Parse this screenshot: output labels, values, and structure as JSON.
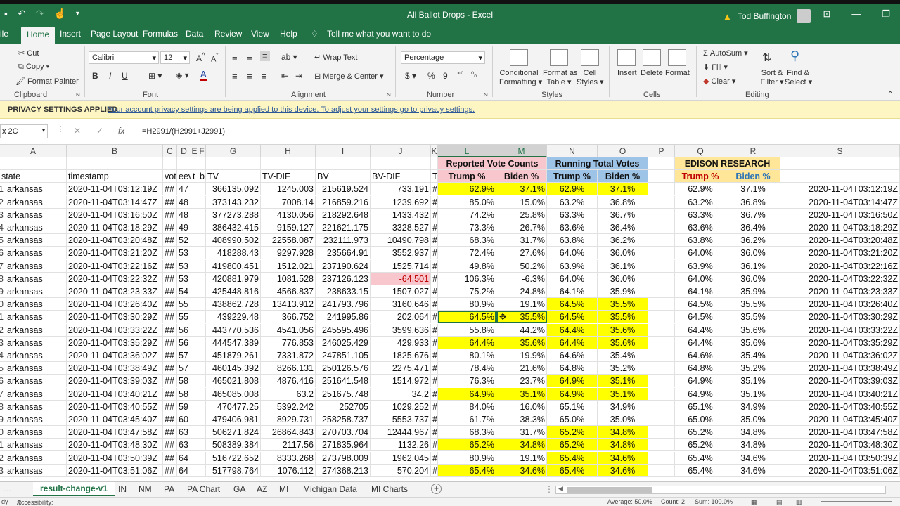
{
  "window": {
    "title": "All Ballot Drops  -  Excel",
    "user": "Tod Buffington",
    "min": "—",
    "restore": "❐"
  },
  "tabs": [
    "ile",
    "Home",
    "Insert",
    "Page Layout",
    "Formulas",
    "Data",
    "Review",
    "View",
    "Help"
  ],
  "tellme": "Tell me what you want to do",
  "ribbon": {
    "clipboard": {
      "cut": "Cut",
      "copy": "Copy",
      "painter": "Format Painter",
      "label": "Clipboard"
    },
    "font": {
      "name": "Calibri",
      "size": "12",
      "label": "Font",
      "bold": "B",
      "italic": "I",
      "underline": "U"
    },
    "alignment": {
      "wrap": "Wrap Text",
      "merge": "Merge & Center",
      "label": "Alignment"
    },
    "number": {
      "format": "Percentage",
      "label": "Number",
      "dollar": "$",
      "pct": "%",
      "comma": "9"
    },
    "styles": {
      "cond": "Conditional",
      "cond2": "Formatting",
      "fmt_table": "Format as",
      "fmt_table2": "Table",
      "cell": "Cell",
      "cell2": "Styles",
      "label": "Styles"
    },
    "cells": {
      "insert": "Insert",
      "delete": "Delete",
      "format": "Format",
      "label": "Cells"
    },
    "editing": {
      "autosum": "AutoSum",
      "fill": "Fill",
      "clear": "Clear",
      "sort": "Sort &",
      "sort2": "Filter",
      "find": "Find &",
      "find2": "Select",
      "label": "Editing"
    }
  },
  "privacy": {
    "label": "PRIVACY SETTINGS APPLIED",
    "message": "Your account privacy settings are being applied to this device. To adjust your settings go to privacy settings."
  },
  "formula_bar": {
    "name_box": "x 2C",
    "cancel": "✕",
    "enter": "✓",
    "fx": "fx",
    "formula": "=H2991/(H2991+J2991)"
  },
  "columns": [
    "A",
    "B",
    "C",
    "D",
    "E",
    "F",
    "G",
    "H",
    "I",
    "J",
    "K",
    "L",
    "M",
    "N",
    "O",
    "P",
    "Q",
    "R",
    "S"
  ],
  "top_headers": {
    "reported": "Reported Vote Counts",
    "running": "Running Total Votes",
    "edison": "EDISON RESEARCH"
  },
  "sub_headers": {
    "state": "state",
    "timestamp": "timestamp",
    "c": "vot",
    "d": "eev",
    "e": "t",
    "f": "b",
    "g": "TV",
    "h": "TV-DIF",
    "i": "BV",
    "j": "BV-DIF",
    "k": "T",
    "trump": "Trump %",
    "biden": "Biden %",
    "trump2": "Trump %",
    "biden2": "Biden %",
    "trump3": "Trump %",
    "biden3": "Biden %"
  },
  "rows": [
    {
      "rn": "1",
      "state": "arkansas",
      "ts": "2020-11-04T03:12:19Z",
      "c": "##",
      "d": "47",
      "tv": "366135.092",
      "tvd": "1245.003",
      "bv": "215619.524",
      "bvd": "733.191",
      "k": "#",
      "l": "62.9%",
      "m": "37.1%",
      "n": "62.9%",
      "o": "37.1%",
      "q": "62.9%",
      "r": "37.1%",
      "s": "2020-11-04T03:12:19Z",
      "ly": true,
      "ny": true
    },
    {
      "rn": "2",
      "state": "arkansas",
      "ts": "2020-11-04T03:14:47Z",
      "c": "##",
      "d": "48",
      "tv": "373143.232",
      "tvd": "7008.14",
      "bv": "216859.216",
      "bvd": "1239.692",
      "k": "#",
      "l": "85.0%",
      "m": "15.0%",
      "n": "63.2%",
      "o": "36.8%",
      "q": "63.2%",
      "r": "36.8%",
      "s": "2020-11-04T03:14:47Z",
      "ly": false,
      "ny": false
    },
    {
      "rn": "3",
      "state": "arkansas",
      "ts": "2020-11-04T03:16:50Z",
      "c": "##",
      "d": "48",
      "tv": "377273.288",
      "tvd": "4130.056",
      "bv": "218292.648",
      "bvd": "1433.432",
      "k": "#",
      "l": "74.2%",
      "m": "25.8%",
      "n": "63.3%",
      "o": "36.7%",
      "q": "63.3%",
      "r": "36.7%",
      "s": "2020-11-04T03:16:50Z",
      "ly": false,
      "ny": false
    },
    {
      "rn": "4",
      "state": "arkansas",
      "ts": "2020-11-04T03:18:29Z",
      "c": "##",
      "d": "49",
      "tv": "386432.415",
      "tvd": "9159.127",
      "bv": "221621.175",
      "bvd": "3328.527",
      "k": "#",
      "l": "73.3%",
      "m": "26.7%",
      "n": "63.6%",
      "o": "36.4%",
      "q": "63.6%",
      "r": "36.4%",
      "s": "2020-11-04T03:18:29Z",
      "ly": false,
      "ny": false
    },
    {
      "rn": "5",
      "state": "arkansas",
      "ts": "2020-11-04T03:20:48Z",
      "c": "##",
      "d": "52",
      "tv": "408990.502",
      "tvd": "22558.087",
      "bv": "232111.973",
      "bvd": "10490.798",
      "k": "#",
      "l": "68.3%",
      "m": "31.7%",
      "n": "63.8%",
      "o": "36.2%",
      "q": "63.8%",
      "r": "36.2%",
      "s": "2020-11-04T03:20:48Z",
      "ly": false,
      "ny": false
    },
    {
      "rn": "6",
      "state": "arkansas",
      "ts": "2020-11-04T03:21:20Z",
      "c": "##",
      "d": "53",
      "tv": "418288.43",
      "tvd": "9297.928",
      "bv": "235664.91",
      "bvd": "3552.937",
      "k": "#",
      "l": "72.4%",
      "m": "27.6%",
      "n": "64.0%",
      "o": "36.0%",
      "q": "64.0%",
      "r": "36.0%",
      "s": "2020-11-04T03:21:20Z",
      "ly": false,
      "ny": false
    },
    {
      "rn": "7",
      "state": "arkansas",
      "ts": "2020-11-04T03:22:16Z",
      "c": "##",
      "d": "53",
      "tv": "419800.451",
      "tvd": "1512.021",
      "bv": "237190.624",
      "bvd": "1525.714",
      "k": "#",
      "l": "49.8%",
      "m": "50.2%",
      "n": "63.9%",
      "o": "36.1%",
      "q": "63.9%",
      "r": "36.1%",
      "s": "2020-11-04T03:22:16Z",
      "ly": false,
      "ny": false
    },
    {
      "rn": "8",
      "state": "arkansas",
      "ts": "2020-11-04T03:22:32Z",
      "c": "##",
      "d": "53",
      "tv": "420881.979",
      "tvd": "1081.528",
      "bv": "237126.123",
      "bvd": "-64.501",
      "k": "#",
      "l": "106.3%",
      "m": "-6.3%",
      "n": "64.0%",
      "o": "36.0%",
      "q": "64.0%",
      "r": "36.0%",
      "s": "2020-11-04T03:22:32Z",
      "ly": false,
      "ny": false,
      "neg": true
    },
    {
      "rn": "9",
      "state": "arkansas",
      "ts": "2020-11-04T03:23:33Z",
      "c": "##",
      "d": "54",
      "tv": "425448.816",
      "tvd": "4566.837",
      "bv": "238633.15",
      "bvd": "1507.027",
      "k": "#",
      "l": "75.2%",
      "m": "24.8%",
      "n": "64.1%",
      "o": "35.9%",
      "q": "64.1%",
      "r": "35.9%",
      "s": "2020-11-04T03:23:33Z",
      "ly": false,
      "ny": false
    },
    {
      "rn": "0",
      "state": "arkansas",
      "ts": "2020-11-04T03:26:40Z",
      "c": "##",
      "d": "55",
      "tv": "438862.728",
      "tvd": "13413.912",
      "bv": "241793.796",
      "bvd": "3160.646",
      "k": "#",
      "l": "80.9%",
      "m": "19.1%",
      "n": "64.5%",
      "o": "35.5%",
      "q": "64.5%",
      "r": "35.5%",
      "s": "2020-11-04T03:26:40Z",
      "ly": false,
      "ny": true
    },
    {
      "rn": "1",
      "state": "arkansas",
      "ts": "2020-11-04T03:30:29Z",
      "c": "##",
      "d": "55",
      "tv": "439229.48",
      "tvd": "366.752",
      "bv": "241995.86",
      "bvd": "202.064",
      "k": "#",
      "l": "64.5%",
      "m": "35.5%",
      "n": "64.5%",
      "o": "35.5%",
      "q": "64.5%",
      "r": "35.5%",
      "s": "2020-11-04T03:30:29Z",
      "ly": true,
      "ny": true,
      "active": true
    },
    {
      "rn": "2",
      "state": "arkansas",
      "ts": "2020-11-04T03:33:22Z",
      "c": "##",
      "d": "56",
      "tv": "443770.536",
      "tvd": "4541.056",
      "bv": "245595.496",
      "bvd": "3599.636",
      "k": "#",
      "l": "55.8%",
      "m": "44.2%",
      "n": "64.4%",
      "o": "35.6%",
      "q": "64.4%",
      "r": "35.6%",
      "s": "2020-11-04T03:33:22Z",
      "ly": false,
      "ny": true
    },
    {
      "rn": "3",
      "state": "arkansas",
      "ts": "2020-11-04T03:35:29Z",
      "c": "##",
      "d": "56",
      "tv": "444547.389",
      "tvd": "776.853",
      "bv": "246025.429",
      "bvd": "429.933",
      "k": "#",
      "l": "64.4%",
      "m": "35.6%",
      "n": "64.4%",
      "o": "35.6%",
      "q": "64.4%",
      "r": "35.6%",
      "s": "2020-11-04T03:35:29Z",
      "ly": true,
      "ny": true
    },
    {
      "rn": "4",
      "state": "arkansas",
      "ts": "2020-11-04T03:36:02Z",
      "c": "##",
      "d": "57",
      "tv": "451879.261",
      "tvd": "7331.872",
      "bv": "247851.105",
      "bvd": "1825.676",
      "k": "#",
      "l": "80.1%",
      "m": "19.9%",
      "n": "64.6%",
      "o": "35.4%",
      "q": "64.6%",
      "r": "35.4%",
      "s": "2020-11-04T03:36:02Z",
      "ly": false,
      "ny": false
    },
    {
      "rn": "5",
      "state": "arkansas",
      "ts": "2020-11-04T03:38:49Z",
      "c": "##",
      "d": "57",
      "tv": "460145.392",
      "tvd": "8266.131",
      "bv": "250126.576",
      "bvd": "2275.471",
      "k": "#",
      "l": "78.4%",
      "m": "21.6%",
      "n": "64.8%",
      "o": "35.2%",
      "q": "64.8%",
      "r": "35.2%",
      "s": "2020-11-04T03:38:49Z",
      "ly": false,
      "ny": false
    },
    {
      "rn": "6",
      "state": "arkansas",
      "ts": "2020-11-04T03:39:03Z",
      "c": "##",
      "d": "58",
      "tv": "465021.808",
      "tvd": "4876.416",
      "bv": "251641.548",
      "bvd": "1514.972",
      "k": "#",
      "l": "76.3%",
      "m": "23.7%",
      "n": "64.9%",
      "o": "35.1%",
      "q": "64.9%",
      "r": "35.1%",
      "s": "2020-11-04T03:39:03Z",
      "ly": false,
      "ny": true
    },
    {
      "rn": "7",
      "state": "arkansas",
      "ts": "2020-11-04T03:40:21Z",
      "c": "##",
      "d": "58",
      "tv": "465085.008",
      "tvd": "63.2",
      "bv": "251675.748",
      "bvd": "34.2",
      "k": "#",
      "l": "64.9%",
      "m": "35.1%",
      "n": "64.9%",
      "o": "35.1%",
      "q": "64.9%",
      "r": "35.1%",
      "s": "2020-11-04T03:40:21Z",
      "ly": true,
      "ny": true
    },
    {
      "rn": "8",
      "state": "arkansas",
      "ts": "2020-11-04T03:40:55Z",
      "c": "##",
      "d": "59",
      "tv": "470477.25",
      "tvd": "5392.242",
      "bv": "252705",
      "bvd": "1029.252",
      "k": "#",
      "l": "84.0%",
      "m": "16.0%",
      "n": "65.1%",
      "o": "34.9%",
      "q": "65.1%",
      "r": "34.9%",
      "s": "2020-11-04T03:40:55Z",
      "ly": false,
      "ny": false
    },
    {
      "rn": "9",
      "state": "arkansas",
      "ts": "2020-11-04T03:45:40Z",
      "c": "##",
      "d": "60",
      "tv": "479406.981",
      "tvd": "8929.731",
      "bv": "258258.737",
      "bvd": "5553.737",
      "k": "#",
      "l": "61.7%",
      "m": "38.3%",
      "n": "65.0%",
      "o": "35.0%",
      "q": "65.0%",
      "r": "35.0%",
      "s": "2020-11-04T03:45:40Z",
      "ly": false,
      "ny": false
    },
    {
      "rn": "0",
      "state": "arkansas",
      "ts": "2020-11-04T03:47:58Z",
      "c": "##",
      "d": "63",
      "tv": "506271.824",
      "tvd": "26864.843",
      "bv": "270703.704",
      "bvd": "12444.967",
      "k": "#",
      "l": "68.3%",
      "m": "31.7%",
      "n": "65.2%",
      "o": "34.8%",
      "q": "65.2%",
      "r": "34.8%",
      "s": "2020-11-04T03:47:58Z",
      "ly": false,
      "ny": true
    },
    {
      "rn": "1",
      "state": "arkansas",
      "ts": "2020-11-04T03:48:30Z",
      "c": "##",
      "d": "63",
      "tv": "508389.384",
      "tvd": "2117.56",
      "bv": "271835.964",
      "bvd": "1132.26",
      "k": "#",
      "l": "65.2%",
      "m": "34.8%",
      "n": "65.2%",
      "o": "34.8%",
      "q": "65.2%",
      "r": "34.8%",
      "s": "2020-11-04T03:48:30Z",
      "ly": true,
      "ny": true
    },
    {
      "rn": "2",
      "state": "arkansas",
      "ts": "2020-11-04T03:50:39Z",
      "c": "##",
      "d": "64",
      "tv": "516722.652",
      "tvd": "8333.268",
      "bv": "273798.009",
      "bvd": "1962.045",
      "k": "#",
      "l": "80.9%",
      "m": "19.1%",
      "n": "65.4%",
      "o": "34.6%",
      "q": "65.4%",
      "r": "34.6%",
      "s": "2020-11-04T03:50:39Z",
      "ly": false,
      "ny": true
    },
    {
      "rn": "3",
      "state": "arkansas",
      "ts": "2020-11-04T03:51:06Z",
      "c": "##",
      "d": "64",
      "tv": "517798.764",
      "tvd": "1076.112",
      "bv": "274368.213",
      "bvd": "570.204",
      "k": "#",
      "l": "65.4%",
      "m": "34.6%",
      "n": "65.4%",
      "o": "34.6%",
      "q": "65.4%",
      "r": "34.6%",
      "s": "2020-11-04T03:51:06Z",
      "ly": true,
      "ny": true
    }
  ],
  "sheet_tabs": [
    "result-change-v1",
    "IN",
    "NM",
    "PA",
    "PA Chart",
    "GA",
    "AZ",
    "MI",
    "Michigan Data",
    "MI Charts"
  ],
  "add_sheet": "+",
  "status": {
    "ready": "dy",
    "accessibility": "Accessibility: Investigate",
    "average": "Average: 50.0%",
    "count": "Count: 2",
    "sum": "Sum: 100.0%"
  },
  "colors": {
    "excel_green": "#217346",
    "highlight_yellow": "#ffff00",
    "reported_pink": "#f8c7ce",
    "running_blue": "#9dc3e6",
    "edison_tan": "#ffe699"
  }
}
